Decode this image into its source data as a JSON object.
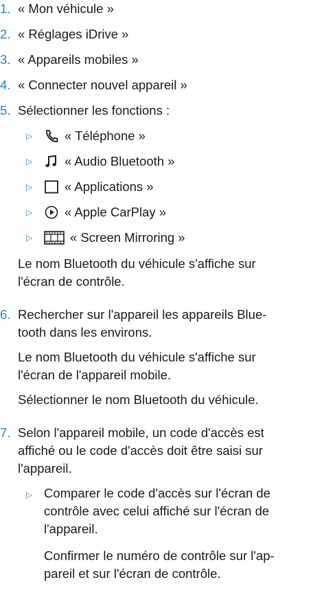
{
  "steps": [
    {
      "num": "1.",
      "text": "« Mon véhicule »"
    },
    {
      "num": "2.",
      "text": "« Réglages iDrive »"
    },
    {
      "num": "3.",
      "text": "« Appareils mobiles »"
    },
    {
      "num": "4.",
      "text": "« Connecter nouvel appareil »"
    },
    {
      "num": "5.",
      "text": "Sélectionner les fonctions :"
    },
    {
      "num": "6.",
      "lines": [
        "Rechercher sur l'appareil les appareils Blue-",
        "tooth dans les environs."
      ]
    },
    {
      "num": "7.",
      "lines": [
        "Selon l'appareil mobile, un code d'accès est",
        "affiché ou le code d'accès doit être saisi sur",
        "l'appareil."
      ]
    }
  ],
  "functions": [
    {
      "icon": "phone-icon",
      "label": "« Téléphone »"
    },
    {
      "icon": "music-note-icon",
      "label": "« Audio Bluetooth »"
    },
    {
      "icon": "square-icon",
      "label": "« Applications »"
    },
    {
      "icon": "play-circle-icon",
      "label": "« Apple CarPlay »"
    },
    {
      "icon": "film-icon",
      "label": "« Screen Mirroring »"
    }
  ],
  "step5_note": [
    "Le nom Bluetooth du véhicule s'affiche sur",
    "l'écran de contrôle."
  ],
  "step6_notes": [
    [
      "Le nom Bluetooth du véhicule s'affiche sur",
      "l'écran de l'appareil mobile."
    ],
    [
      "Sélectionner le nom Bluetooth du véhicule."
    ]
  ],
  "step7_sub": {
    "marker": "▷",
    "lines": [
      "Comparer le code d'accès sur l'écran de",
      "contrôle avec celui affiché sur l'écran de",
      "l'appareil."
    ],
    "note": [
      "Confirmer le numéro de contrôle sur l'ap-",
      "pareil et sur l'écran de contrôle."
    ]
  },
  "bullet_marker": "▷",
  "colors": {
    "accent": "#1e86c8",
    "text": "#1a1a1a"
  }
}
